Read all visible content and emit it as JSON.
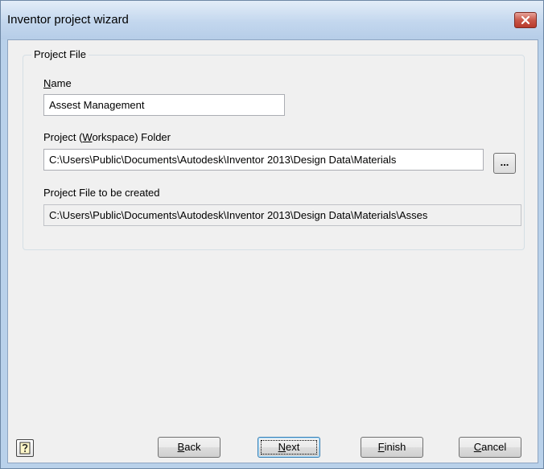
{
  "window": {
    "title": "Inventor project wizard"
  },
  "project_file": {
    "legend": "Project File",
    "name_label_u": "N",
    "name_label_rest": "ame",
    "name_value": "Assest Management",
    "workspace_label_pre": "Project (",
    "workspace_label_u": "W",
    "workspace_label_post": "orkspace) Folder",
    "workspace_value": "C:\\Users\\Public\\Documents\\Autodesk\\Inventor 2013\\Design Data\\Materials",
    "browse_label": "...",
    "created_label": "Project File to be created",
    "created_value": "C:\\Users\\Public\\Documents\\Autodesk\\Inventor 2013\\Design Data\\Materials\\Asses"
  },
  "buttons": {
    "back_u": "B",
    "back_rest": "ack",
    "next_u": "N",
    "next_rest": "ext",
    "finish_u": "F",
    "finish_rest": "inish",
    "cancel_u": "C",
    "cancel_rest": "ancel"
  },
  "icons": {
    "help": "help-icon",
    "close": "close-icon"
  },
  "colors": {
    "close_button": "#c9584a",
    "titlebar": "#c3d7ee",
    "dialog_bg": "#f0f0f0"
  }
}
